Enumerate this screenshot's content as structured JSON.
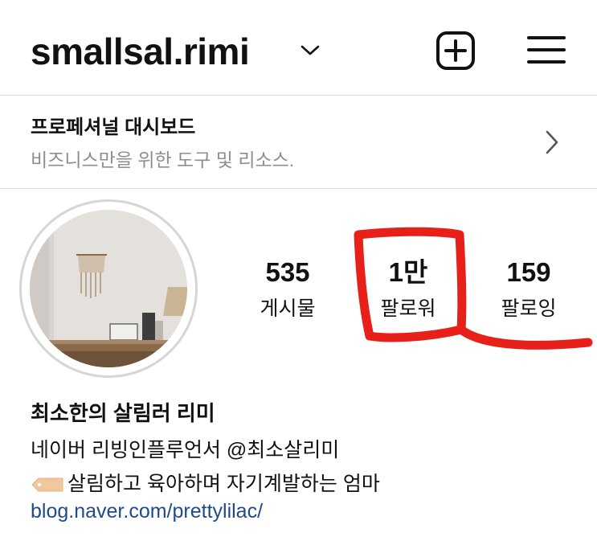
{
  "header": {
    "username": "smallsal.rimi",
    "icons": {
      "dropdown": "chevron-down-icon",
      "add": "add-square-icon",
      "menu": "hamburger-menu-icon"
    }
  },
  "dashboard": {
    "title": "프로페셔널 대시보드",
    "subtitle": "비즈니스만을 위한 도구 및 리소스.",
    "icon": "chevron-right-icon"
  },
  "stats": [
    {
      "value": "535",
      "label": "게시물"
    },
    {
      "value": "1만",
      "label": "팔로워"
    },
    {
      "value": "159",
      "label": "팔로잉"
    }
  ],
  "bio": {
    "name": "최소한의 살림러 리미",
    "line1": "네이버 리빙인플루언서 @최소살리미",
    "line2": "살림하고 육아하며 자기계발하는 엄마",
    "line2_icon": "label-tag-emoji",
    "link": "blog.naver.com/prettylilac/"
  },
  "colors": {
    "link": "#1f4b8a",
    "secondary_text": "#8e8e8e",
    "highlight_mark": "#e8201a"
  }
}
